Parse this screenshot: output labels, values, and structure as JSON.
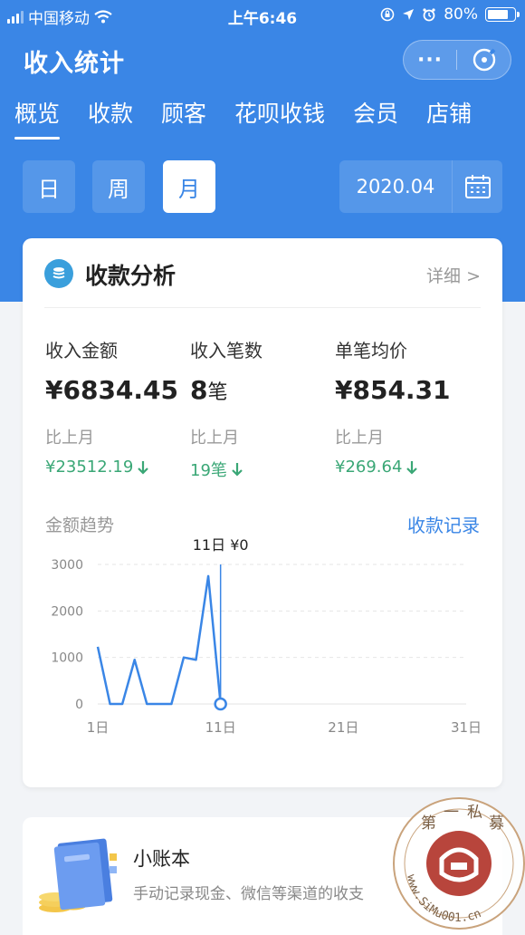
{
  "status_bar": {
    "carrier": "中国移动",
    "time": "上午6:46",
    "battery": "80%"
  },
  "header": {
    "title": "收入统计",
    "more_label": "···"
  },
  "tabs": [
    {
      "label": "概览",
      "active": true
    },
    {
      "label": "收款",
      "active": false
    },
    {
      "label": "顾客",
      "active": false
    },
    {
      "label": "花呗收钱",
      "active": false
    },
    {
      "label": "会员",
      "active": false
    },
    {
      "label": "店铺",
      "active": false
    }
  ],
  "periods": [
    {
      "label": "日",
      "active": false
    },
    {
      "label": "周",
      "active": false
    },
    {
      "label": "月",
      "active": true
    }
  ],
  "date_value": "2020.04",
  "analysis": {
    "title": "收款分析",
    "detail_link": "详细 >",
    "metrics": [
      {
        "label": "收入金额",
        "value": "¥6834.45",
        "unit": "",
        "compare_label": "比上月",
        "prev_value": "¥23512.19"
      },
      {
        "label": "收入笔数",
        "value": "8",
        "unit": "笔",
        "compare_label": "比上月",
        "prev_value": "19笔"
      },
      {
        "label": "单笔均价",
        "value": "¥854.31",
        "unit": "",
        "compare_label": "比上月",
        "prev_value": "¥269.64"
      }
    ],
    "trend_title": "金额趋势",
    "records_link": "收款记录",
    "tooltip": "11日 ¥0"
  },
  "chart_data": {
    "type": "line",
    "x": [
      1,
      2,
      3,
      4,
      5,
      6,
      7,
      8,
      9,
      10,
      11
    ],
    "values": [
      1230,
      0,
      0,
      950,
      0,
      0,
      0,
      1000,
      950,
      2750,
      0
    ],
    "y_ticks": [
      "0",
      "1000",
      "2000",
      "3000"
    ],
    "x_ticks": [
      "1日",
      "11日",
      "21日",
      "31日"
    ],
    "xlim": [
      1,
      31
    ],
    "ylim": [
      0,
      3000
    ],
    "highlight_x": 11,
    "grid": true,
    "color": "#3a86e6"
  },
  "ledger": {
    "title": "小账本",
    "desc": "手动记录现金、微信等渠道的收支"
  },
  "watermark": {
    "chars": [
      "第",
      "一",
      "私",
      "募"
    ],
    "url": "www.SiMu001.cn"
  },
  "colors": {
    "brand": "#3a86e6",
    "down": "#3aa776"
  }
}
